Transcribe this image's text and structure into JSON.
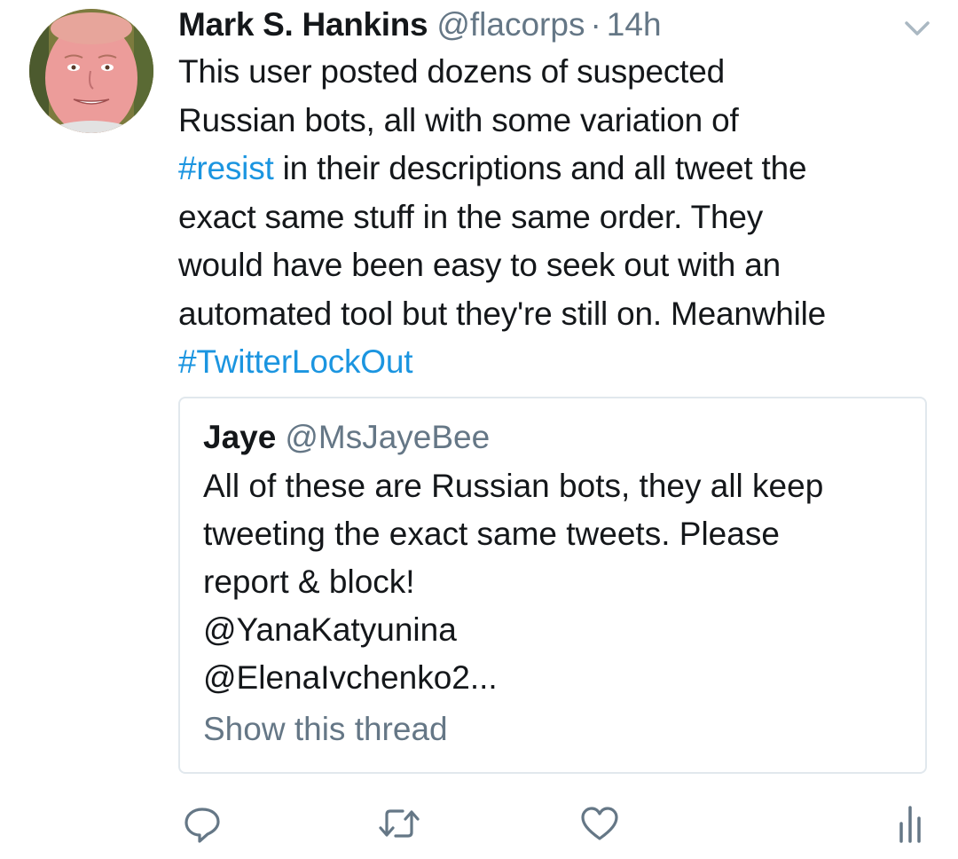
{
  "tweet": {
    "display_name": "Mark S. Hankins",
    "handle": "@flacorps",
    "separator": "·",
    "time": "14h",
    "avatar_icon": "profile-photo",
    "caret_icon": "chevron-down-icon",
    "text_lines": [
      {
        "plain": "This user posted dozens of suspected"
      },
      {
        "plain": "Russian bots, all with some variation of"
      },
      {
        "hashtag": "#resist",
        "rest": " in their descriptions and all tweet the"
      },
      {
        "plain": "exact same stuff in the same order. They"
      },
      {
        "plain": "would have been easy to seek out with an"
      },
      {
        "plain": "automated tool but they're still on. Meanwhile"
      },
      {
        "hashtag": "#TwitterLockOut"
      }
    ]
  },
  "quoted": {
    "display_name": "Jaye",
    "handle": "@MsJayeBee",
    "text_lines": [
      "All of these are Russian bots, they all keep",
      "tweeting the exact same tweets. Please",
      "report & block!",
      "@YanaKatyunina",
      "@ElenaIvchenko2..."
    ],
    "show_thread": "Show this thread"
  },
  "actions": {
    "reply_icon": "reply-icon",
    "retweet_icon": "retweet-icon",
    "like_icon": "heart-icon",
    "analytics_icon": "analytics-icon"
  },
  "colors": {
    "hashtag": "#1b95e0",
    "secondary": "#657786",
    "text": "#14171a",
    "border": "#e1e8ed"
  }
}
